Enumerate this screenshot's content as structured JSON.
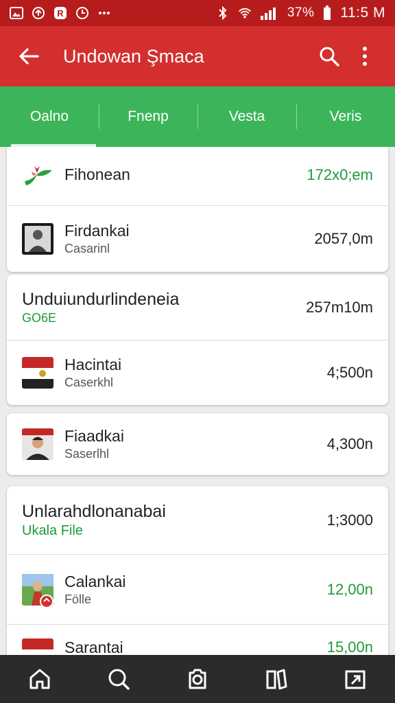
{
  "status_bar": {
    "battery_percent": "37%",
    "time": "11:5 M",
    "icons": [
      "gallery-icon",
      "sync-icon",
      "notification-icon",
      "clock-icon",
      "more-dots-icon",
      "bluetooth-icon",
      "wifi-icon",
      "signal-icon",
      "battery-icon"
    ]
  },
  "app_bar": {
    "title": "Undowan Şmaca",
    "back_icon": "arrow-left-icon",
    "search_icon": "search-icon",
    "menu_icon": "more-vert-icon"
  },
  "tabs": [
    {
      "label": "Oalno",
      "active": true
    },
    {
      "label": "Fnenp",
      "active": false
    },
    {
      "label": "Vesta",
      "active": false
    },
    {
      "label": "Veris",
      "active": false
    }
  ],
  "list": {
    "card1": {
      "rows": [
        {
          "name": "Fihonean",
          "size": "172x0;em",
          "icon": "plant-logo-icon"
        },
        {
          "name": "Firdankai",
          "sub": "Casarinl",
          "size": "2057,0m",
          "icon": "photo-thumbnail"
        }
      ]
    },
    "card2": {
      "header": {
        "title": "Unduiundurlindeneia",
        "sub": "GO6E",
        "size": "257m10m"
      },
      "rows": [
        {
          "name": "Hacintai",
          "sub": "Caserkhl",
          "size": "4;500n",
          "icon": "flag-thumbnail"
        }
      ]
    },
    "card3": {
      "rows": [
        {
          "name": "Fiaadkai",
          "sub": "Saserlhl",
          "size": "4,300n",
          "icon": "portrait-thumbnail"
        }
      ]
    },
    "card4": {
      "header": {
        "title": "Unlarahdlonanabai",
        "sub": "Ukala File",
        "size": "1;3000"
      },
      "rows": [
        {
          "name": "Calankai",
          "sub": "Fölle",
          "size": "12,00n",
          "icon": "person-thumbnail"
        },
        {
          "name": "Sarantai",
          "sub": "",
          "size": "15,00n",
          "icon": "flag-thumbnail"
        }
      ]
    }
  },
  "bottom_nav": [
    "home-icon",
    "search-icon",
    "discover-icon",
    "library-icon",
    "share-icon"
  ],
  "colors": {
    "status_bar": "#b71c1c",
    "app_bar": "#d32f2f",
    "tabs": "#3cb55a",
    "accent_green": "#1e9a3a",
    "bottom_nav": "#2b2b2b"
  }
}
